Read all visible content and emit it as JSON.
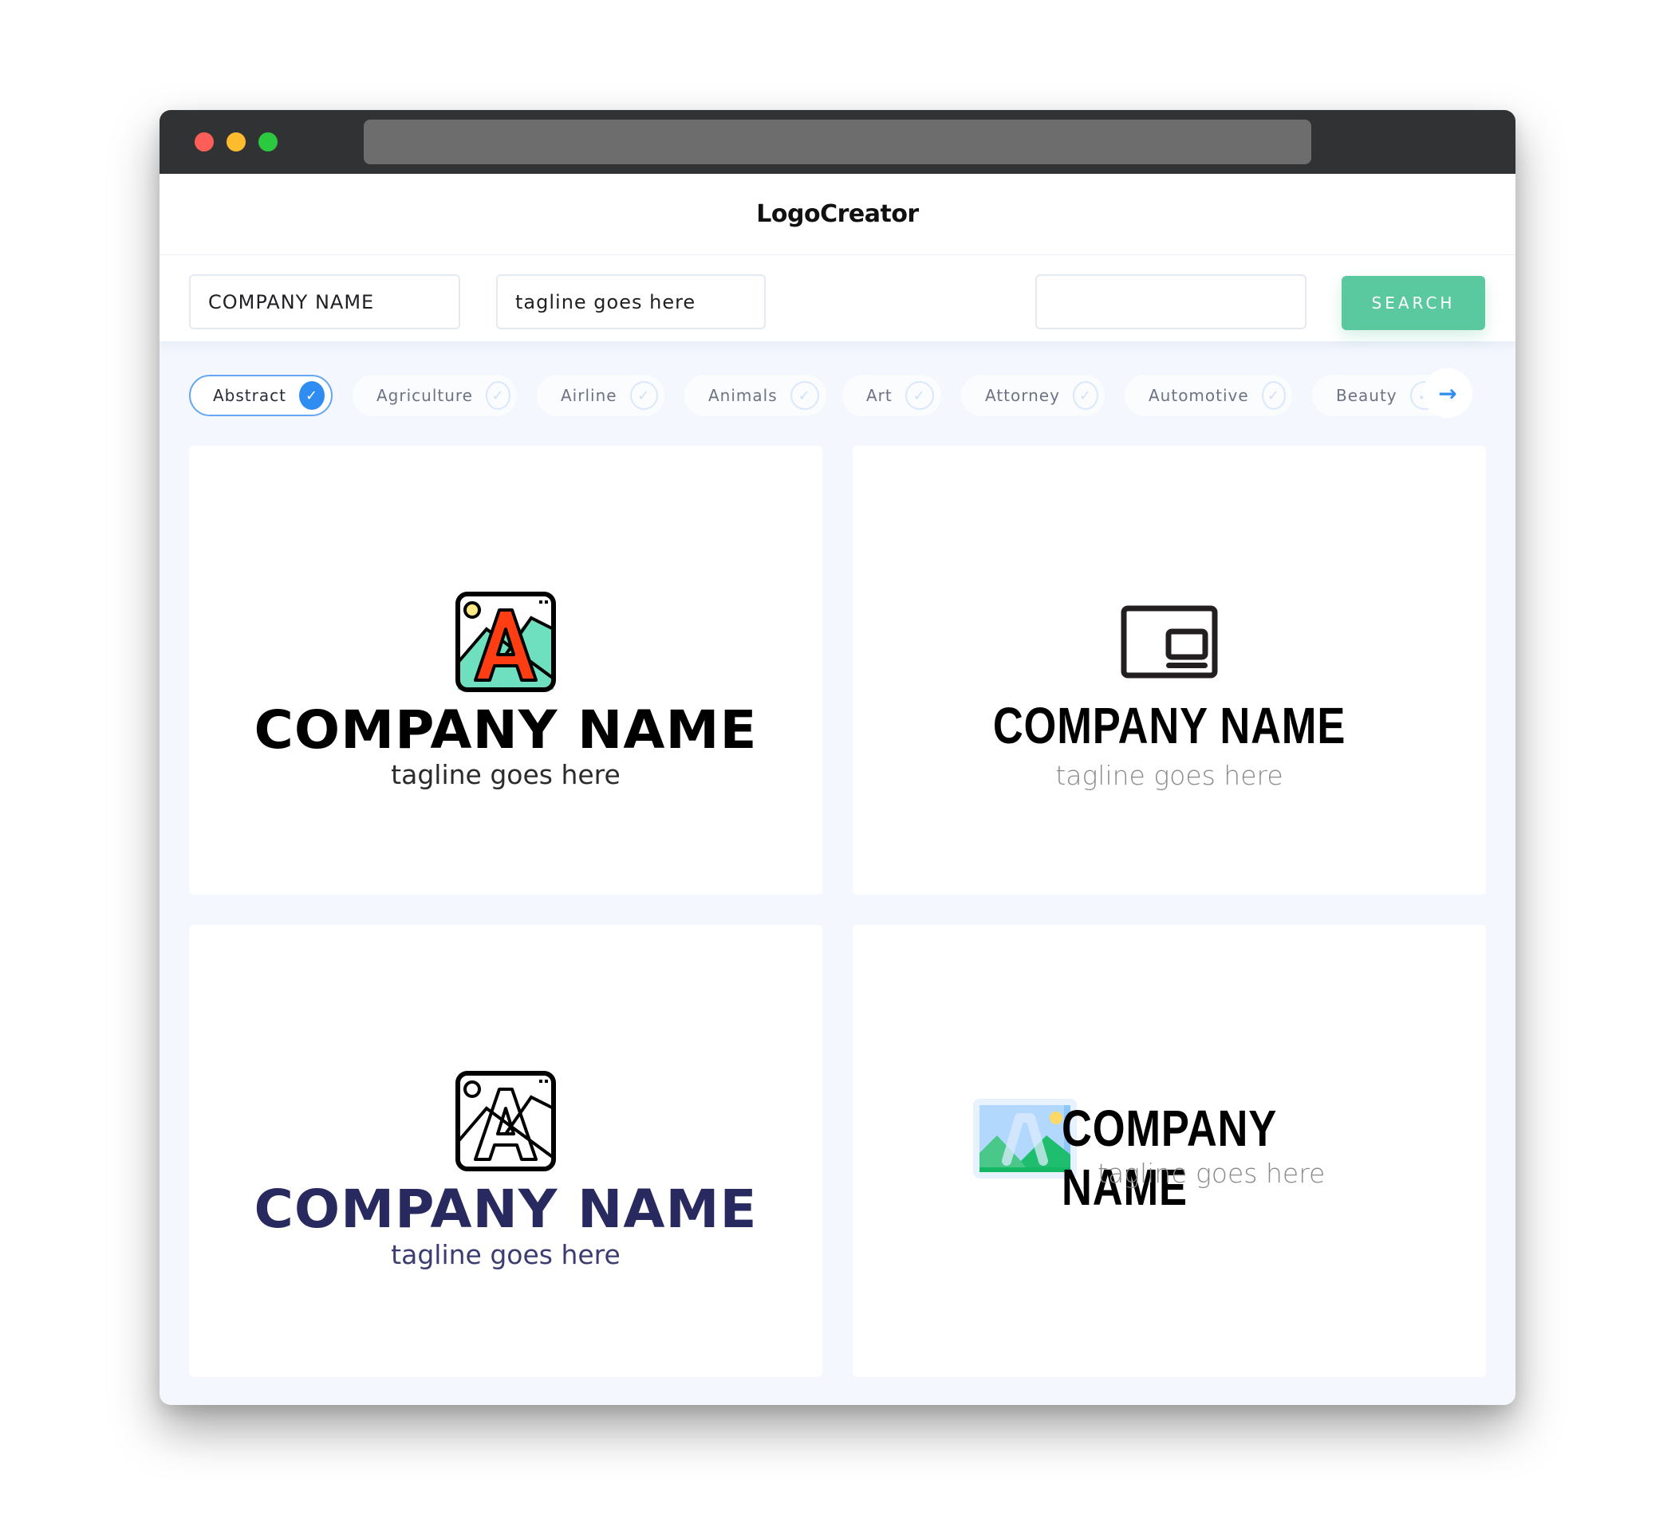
{
  "window": {
    "controls": [
      "close",
      "minimize",
      "maximize"
    ]
  },
  "header": {
    "title": "LogoCreator"
  },
  "search": {
    "company_name_value": "COMPANY NAME",
    "tagline_value": "tagline goes here",
    "query_value": "",
    "button_label": "SEARCH"
  },
  "categories": {
    "items": [
      {
        "label": "Abstract",
        "selected": true
      },
      {
        "label": "Agriculture",
        "selected": false
      },
      {
        "label": "Airline",
        "selected": false
      },
      {
        "label": "Animals",
        "selected": false
      },
      {
        "label": "Art",
        "selected": false
      },
      {
        "label": "Attorney",
        "selected": false
      },
      {
        "label": "Automotive",
        "selected": false
      },
      {
        "label": "Beauty",
        "selected": false
      }
    ],
    "check_glyph": "✓",
    "next_glyph": "→"
  },
  "logos": [
    {
      "icon": "image-letter-a-color-icon",
      "name": "COMPANY NAME",
      "tagline": "tagline goes here",
      "name_color": "#000000",
      "tagline_color": "#2b2b2b"
    },
    {
      "icon": "picture-in-picture-icon",
      "name": "COMPANY NAME",
      "tagline": "tagline goes here",
      "name_color": "#000000",
      "tagline_color": "#8a8a8a"
    },
    {
      "icon": "image-letter-a-outline-icon",
      "name": "COMPANY NAME",
      "tagline": "tagline goes here",
      "name_color": "#28295f",
      "tagline_color": "#3b3c72"
    },
    {
      "icon": "image-letter-a-flat-icon",
      "name": "COMPANY NAME",
      "tagline": "tagline goes here",
      "name_color": "#000000",
      "tagline_color": "#8a8a8a"
    }
  ],
  "colors": {
    "accent": "#2f8cf1",
    "search_button": "#5bc9a0",
    "titlebar": "#313234"
  }
}
